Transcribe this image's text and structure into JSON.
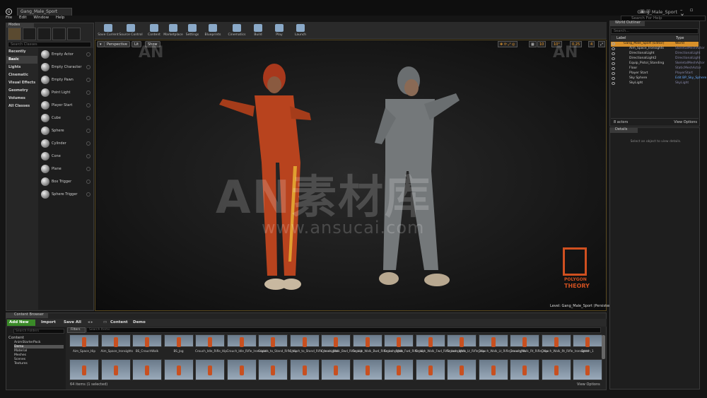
{
  "window": {
    "doc_tab": "Gang_Male_Sport",
    "title": "Gang_Male_Sport",
    "search_help": "Search For Help",
    "buttons": "– ▫ ✕"
  },
  "menu": [
    "File",
    "Edit",
    "Window",
    "Help"
  ],
  "modes": {
    "tab": "Modes",
    "search_placeholder": "Search Classes",
    "categories": [
      "Recently Placed",
      "Basic",
      "Lights",
      "Cinematic",
      "Visual Effects",
      "Geometry",
      "Volumes",
      "All Classes"
    ],
    "selected_category": "Basic",
    "items": [
      "Empty Actor",
      "Empty Character",
      "Empty Pawn",
      "Point Light",
      "Player Start",
      "Cube",
      "Sphere",
      "Cylinder",
      "Cone",
      "Plane",
      "Box Trigger",
      "Sphere Trigger"
    ]
  },
  "toolbar": [
    "Save Current",
    "Source Control",
    "Content",
    "Marketplace",
    "Settings",
    "Blueprints",
    "Cinematics",
    "Build",
    "Play",
    "Launch"
  ],
  "viewport": {
    "perspective": "Perspective",
    "lit": "Lit",
    "show": "Show",
    "snap_grid": "10",
    "snap_rot": "10°",
    "snap_scale": "0.25",
    "cam_speed": "4",
    "level_label": "Level:  Gang_Male_Sport (Persistent)",
    "watermark_cn": "AN素材库",
    "watermark_url": "www.ansucai.com",
    "watermark_small": "AN",
    "logo_name": "POLYGON",
    "logo_name2": "THEORY"
  },
  "outliner": {
    "tab": "World Outliner",
    "search_placeholder": "Search...",
    "col_label": "Label",
    "col_type": "Type",
    "rows": [
      {
        "name": "Gang_Male_Sport (Editor)",
        "type": "World"
      },
      {
        "name": "Aim_Space_Ironsights",
        "type": "SkeletalMeshActor"
      },
      {
        "name": "DirectionalLight",
        "type": "DirectionalLight"
      },
      {
        "name": "DirectionalLight2",
        "type": "DirectionalLight"
      },
      {
        "name": "Equip_Pistol_Standing",
        "type": "SkeletalMeshActor"
      },
      {
        "name": "Floor",
        "type": "StaticMeshActor"
      },
      {
        "name": "Player Start",
        "type": "PlayerStart"
      },
      {
        "name": "Sky Sphere",
        "type": "Edit BP_Sky_Sphere"
      },
      {
        "name": "SkyLight",
        "type": "SkyLight"
      }
    ],
    "count": "8 actors",
    "view_options": "View Options"
  },
  "details": {
    "tab": "Details",
    "message": "Select an object to view details."
  },
  "content_browser": {
    "tab": "Content Browser",
    "add_new": "Add New",
    "import": "Import",
    "save_all": "Save All",
    "path": [
      "Content",
      "Demo"
    ],
    "search_folders": "Search Folders",
    "filters": "Filters",
    "search_assets": "Search Items",
    "tree": [
      "Content",
      "AnimStarterPack",
      "Demo",
      "Material",
      "Meshes",
      "Scenes",
      "Textures"
    ],
    "row1": [
      "Aim_Space_Hip",
      "Aim_Space_Ironsights",
      "BS_CrouchWalk",
      "BS_Jog",
      "Crouch_Idle_Rifle_Hip",
      "Crouch_Idle_Rifle_Ironsights",
      "Crouch_to_Stand_Rifle_Hip",
      "Crouch_to_Stand_Rifle_Ironsights",
      "Crouch_Walk_Bwd_Rifle_Hip",
      "Crouch_Walk_Bwd_Rifle_Ironsights",
      "Crouch_Walk_Fwd_Rifle_Hip",
      "Crouch_Walk_Fwd_Rifle_Ironsights",
      "Crouch_Walk_Lt_Rifle_Hip",
      "Crouch_Walk_Lt_Rifle_Ironsights",
      "Crouch_Walk_Rt_Rifle_Hip",
      "Crouch_Walk_Rt_Rifle_Ironsights",
      "Death_1"
    ],
    "status": "64 items (1 selected)",
    "view_options": "View Options"
  }
}
